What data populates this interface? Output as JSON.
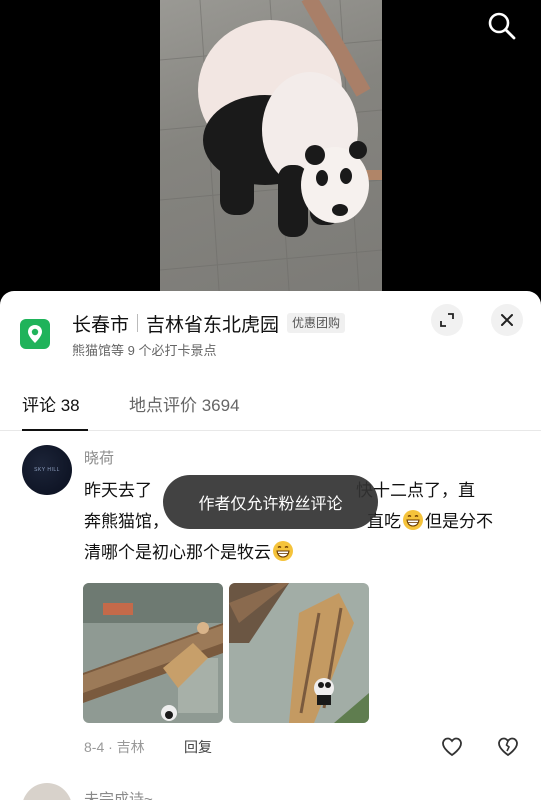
{
  "video": {
    "search_icon": "search-icon"
  },
  "location": {
    "icon": "location-pin-icon",
    "accent_color": "#1fb35a",
    "city": "长春市",
    "place": "吉林省东北虎园",
    "badge": "优惠团购",
    "subtitle": "熊猫馆等 9 个必打卡景点",
    "expand_icon": "expand-icon",
    "close_icon": "close-icon"
  },
  "tabs": [
    {
      "label": "评论 38",
      "active": true
    },
    {
      "label": "地点评价 3694",
      "active": false
    }
  ],
  "comment": {
    "author": "晓荷",
    "line1_start": "昨天去了",
    "line1_end": "快十二点了，直",
    "line2_start": "奔熊猫馆，",
    "line2_mid": "直吃",
    "line2_end": "但是分不",
    "line3": "清哪个是初心那个是牧云",
    "date_location": "8-4 · 吉林",
    "reply_label": "回复",
    "like_icon": "heart-icon",
    "dislike_icon": "broken-heart-icon"
  },
  "toast": {
    "text": "作者仅允许粉丝评论"
  },
  "next_comment": {
    "author": "未完成诗~"
  }
}
